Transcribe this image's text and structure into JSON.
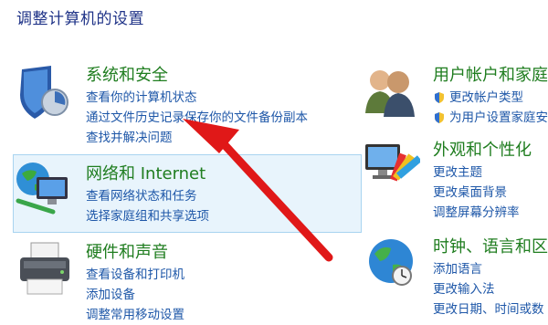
{
  "page": {
    "title": "调整计算机的设置"
  },
  "categories": {
    "security": {
      "title": "系统和安全",
      "icon": "security-shield-icon",
      "links": [
        "查看你的计算机状态",
        "通过文件历史记录保存你的文件备份副本",
        "查找并解决问题"
      ]
    },
    "network": {
      "title": "网络和 Internet",
      "icon": "network-globe-icon",
      "links": [
        "查看网络状态和任务",
        "选择家庭组和共享选项"
      ]
    },
    "hardware": {
      "title": "硬件和声音",
      "icon": "printer-icon",
      "links": [
        "查看设备和打印机",
        "添加设备",
        "调整常用移动设置"
      ]
    },
    "users": {
      "title": "用户帐户和家庭",
      "icon": "users-icon",
      "links": [
        "更改帐户类型",
        "为用户设置家庭安"
      ]
    },
    "appearance": {
      "title": "外观和个性化",
      "icon": "monitor-color-icon",
      "links": [
        "更改主题",
        "更改桌面背景",
        "调整屏幕分辨率"
      ]
    },
    "clock": {
      "title": "时钟、语言和区",
      "icon": "globe-clock-icon",
      "links": [
        "添加语言",
        "更改输入法",
        "更改日期、时间或数"
      ]
    }
  },
  "annotation": {
    "icon": "red-arrow-icon",
    "color": "#e01818"
  }
}
